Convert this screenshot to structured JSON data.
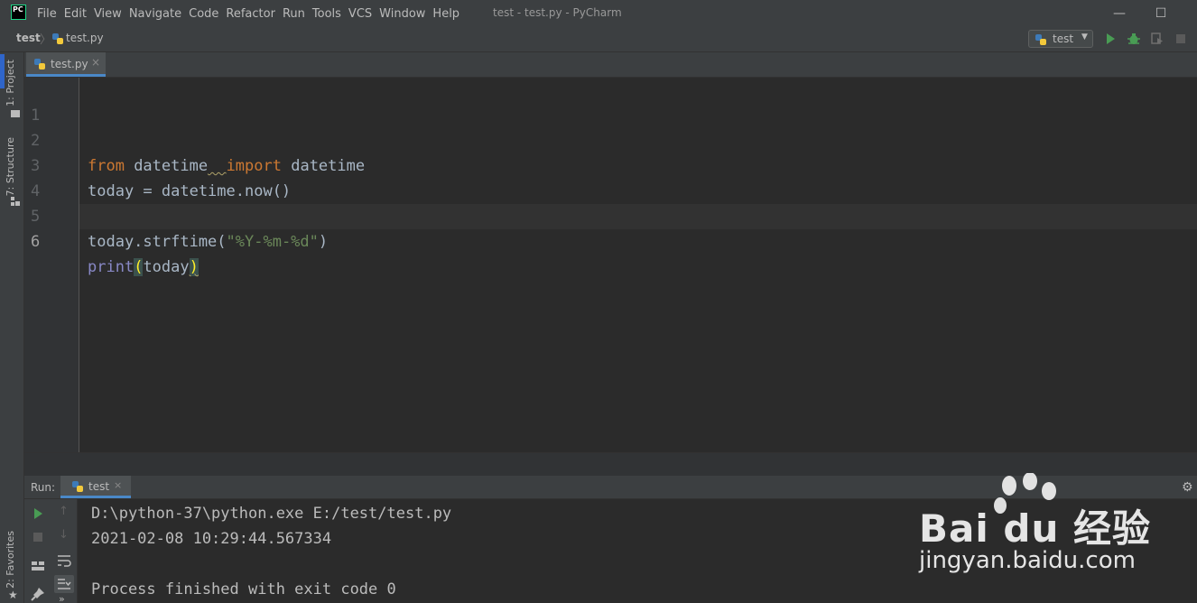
{
  "app": {
    "logo_text": "PC",
    "window_title": "test - test.py - PyCharm"
  },
  "menu": [
    "File",
    "Edit",
    "View",
    "Navigate",
    "Code",
    "Refactor",
    "Run",
    "Tools",
    "VCS",
    "Window",
    "Help"
  ],
  "navbar": {
    "project": "test",
    "file": "test.py",
    "run_config": "test"
  },
  "tool_windows": {
    "project": "1: Project",
    "structure": "7: Structure",
    "favorites": "2: Favorites"
  },
  "editor": {
    "tab_label": "test.py",
    "current_line": 6,
    "line_numbers": [
      "1",
      "2",
      "3",
      "4",
      "5",
      "6"
    ],
    "tokens": {
      "l2_from": "from",
      "l2_mod": " datetime",
      "l2_space": "  ",
      "l2_import": "import",
      "l2_name": " datetime",
      "l3": "today = datetime.now()",
      "l5_call": "today.strftime(",
      "l5_str": "\"%Y-%m-%d\"",
      "l5_close": ")",
      "l6_print": "print",
      "l6_open": "(",
      "l6_arg": "today",
      "l6_close": ")"
    }
  },
  "run_panel": {
    "label": "Run:",
    "tab_label": "test",
    "console": [
      "D:\\python-37\\python.exe E:/test/test.py",
      "2021-02-08 10:29:44.567334",
      "",
      "Process finished with exit code 0"
    ]
  },
  "watermark": {
    "brand": "Bai du 经验",
    "url": "jingyan.baidu.com"
  },
  "colors": {
    "keyword": "#cc7832",
    "string": "#6a8759",
    "builtin": "#8888c6",
    "accent": "#4a88c7",
    "run_green": "#499c54"
  }
}
